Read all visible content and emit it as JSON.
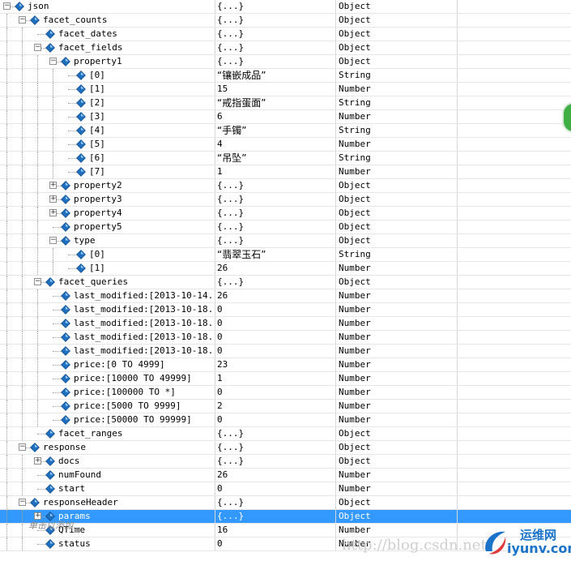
{
  "tree": [
    {
      "name": "json",
      "value": "{...}",
      "type": "Object",
      "level": 0,
      "expander": "-"
    },
    {
      "name": "facet_counts",
      "value": "{...}",
      "type": "Object",
      "level": 1,
      "expander": "-"
    },
    {
      "name": "facet_dates",
      "value": "{...}",
      "type": "Object",
      "level": 2,
      "expander": ""
    },
    {
      "name": "facet_fields",
      "value": "{...}",
      "type": "Object",
      "level": 2,
      "expander": "-"
    },
    {
      "name": "property1",
      "value": "{...}",
      "type": "Object",
      "level": 3,
      "expander": "-"
    },
    {
      "name": "[0]",
      "value": "“镶嵌成品”",
      "type": "String",
      "level": 4,
      "expander": ""
    },
    {
      "name": "[1]",
      "value": "15",
      "type": "Number",
      "level": 4,
      "expander": ""
    },
    {
      "name": "[2]",
      "value": "“戒指蛋面”",
      "type": "String",
      "level": 4,
      "expander": ""
    },
    {
      "name": "[3]",
      "value": "6",
      "type": "Number",
      "level": 4,
      "expander": ""
    },
    {
      "name": "[4]",
      "value": "“手镯”",
      "type": "String",
      "level": 4,
      "expander": ""
    },
    {
      "name": "[5]",
      "value": "4",
      "type": "Number",
      "level": 4,
      "expander": ""
    },
    {
      "name": "[6]",
      "value": "“吊坠”",
      "type": "String",
      "level": 4,
      "expander": ""
    },
    {
      "name": "[7]",
      "value": "1",
      "type": "Number",
      "level": 4,
      "expander": ""
    },
    {
      "name": "property2",
      "value": "{...}",
      "type": "Object",
      "level": 3,
      "expander": "+"
    },
    {
      "name": "property3",
      "value": "{...}",
      "type": "Object",
      "level": 3,
      "expander": "+"
    },
    {
      "name": "property4",
      "value": "{...}",
      "type": "Object",
      "level": 3,
      "expander": "+"
    },
    {
      "name": "property5",
      "value": "{...}",
      "type": "Object",
      "level": 3,
      "expander": ""
    },
    {
      "name": "type",
      "value": "{...}",
      "type": "Object",
      "level": 3,
      "expander": "-"
    },
    {
      "name": "[0]",
      "value": "“翡翠玉石”",
      "type": "String",
      "level": 4,
      "expander": ""
    },
    {
      "name": "[1]",
      "value": "26",
      "type": "Number",
      "level": 4,
      "expander": ""
    },
    {
      "name": "facet_queries",
      "value": "{...}",
      "type": "Object",
      "level": 2,
      "expander": "-"
    },
    {
      "name": "last_modified:[2013-10-14...",
      "value": "26",
      "type": "Number",
      "level": 3,
      "expander": ""
    },
    {
      "name": "last_modified:[2013-10-18...",
      "value": "0",
      "type": "Number",
      "level": 3,
      "expander": ""
    },
    {
      "name": "last_modified:[2013-10-18...",
      "value": "0",
      "type": "Number",
      "level": 3,
      "expander": ""
    },
    {
      "name": "last_modified:[2013-10-18...",
      "value": "0",
      "type": "Number",
      "level": 3,
      "expander": ""
    },
    {
      "name": "last_modified:[2013-10-18...",
      "value": "0",
      "type": "Number",
      "level": 3,
      "expander": ""
    },
    {
      "name": "price:[0 TO 4999]",
      "value": "23",
      "type": "Number",
      "level": 3,
      "expander": ""
    },
    {
      "name": "price:[10000 TO 49999]",
      "value": "1",
      "type": "Number",
      "level": 3,
      "expander": ""
    },
    {
      "name": "price:[100000 TO *]",
      "value": "0",
      "type": "Number",
      "level": 3,
      "expander": ""
    },
    {
      "name": "price:[5000 TO 9999]",
      "value": "2",
      "type": "Number",
      "level": 3,
      "expander": ""
    },
    {
      "name": "price:[50000 TO 99999]",
      "value": "0",
      "type": "Number",
      "level": 3,
      "expander": ""
    },
    {
      "name": "facet_ranges",
      "value": "{...}",
      "type": "Object",
      "level": 2,
      "expander": ""
    },
    {
      "name": "response",
      "value": "{...}",
      "type": "Object",
      "level": 1,
      "expander": "-"
    },
    {
      "name": "docs",
      "value": "{...}",
      "type": "Object",
      "level": 2,
      "expander": "+"
    },
    {
      "name": "numFound",
      "value": "26",
      "type": "Number",
      "level": 2,
      "expander": ""
    },
    {
      "name": "start",
      "value": "0",
      "type": "Number",
      "level": 2,
      "expander": ""
    },
    {
      "name": "responseHeader",
      "value": "{...}",
      "type": "Object",
      "level": 1,
      "expander": "-"
    },
    {
      "name": "params",
      "value": "{...}",
      "type": "Object",
      "level": 2,
      "expander": "+",
      "selected": true
    },
    {
      "name": "QTime",
      "value": "16",
      "type": "Number",
      "level": 2,
      "expander": ""
    },
    {
      "name": "status",
      "value": "0",
      "type": "Number",
      "level": 2,
      "expander": ""
    }
  ],
  "add_row_label": "单击以添加...",
  "watermark_url": "http://blog.csdn.net/",
  "logo_cn": "运维网",
  "logo_en": "iyunv.com",
  "colors": {
    "selection": "#3399ff",
    "icon": "#1f6fbf",
    "widget": "#3fae43"
  }
}
